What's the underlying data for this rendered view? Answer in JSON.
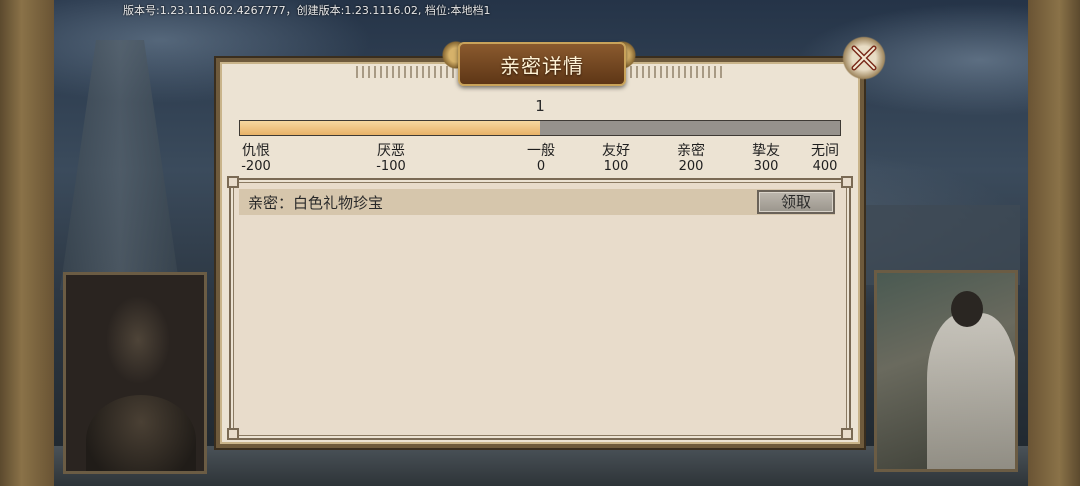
{
  "version_info": "版本号:1.23.1116.02.4267777，创建版本:1.23.1116.02, 档位:本地档1",
  "dialog": {
    "title": "亲密详情",
    "level": "1",
    "progress_fraction": 0.5
  },
  "tiers": [
    {
      "name": "仇恨",
      "value": "-200"
    },
    {
      "name": "厌恶",
      "value": "-100"
    },
    {
      "name": "一般",
      "value": "0"
    },
    {
      "name": "友好",
      "value": "100"
    },
    {
      "name": "亲密",
      "value": "200"
    },
    {
      "name": "挚友",
      "value": "300"
    },
    {
      "name": "无间",
      "value": "400"
    }
  ],
  "rewards": [
    {
      "text": "亲密：白色礼物珍宝",
      "button": "领取"
    }
  ],
  "icons": {
    "close": "close-icon"
  }
}
